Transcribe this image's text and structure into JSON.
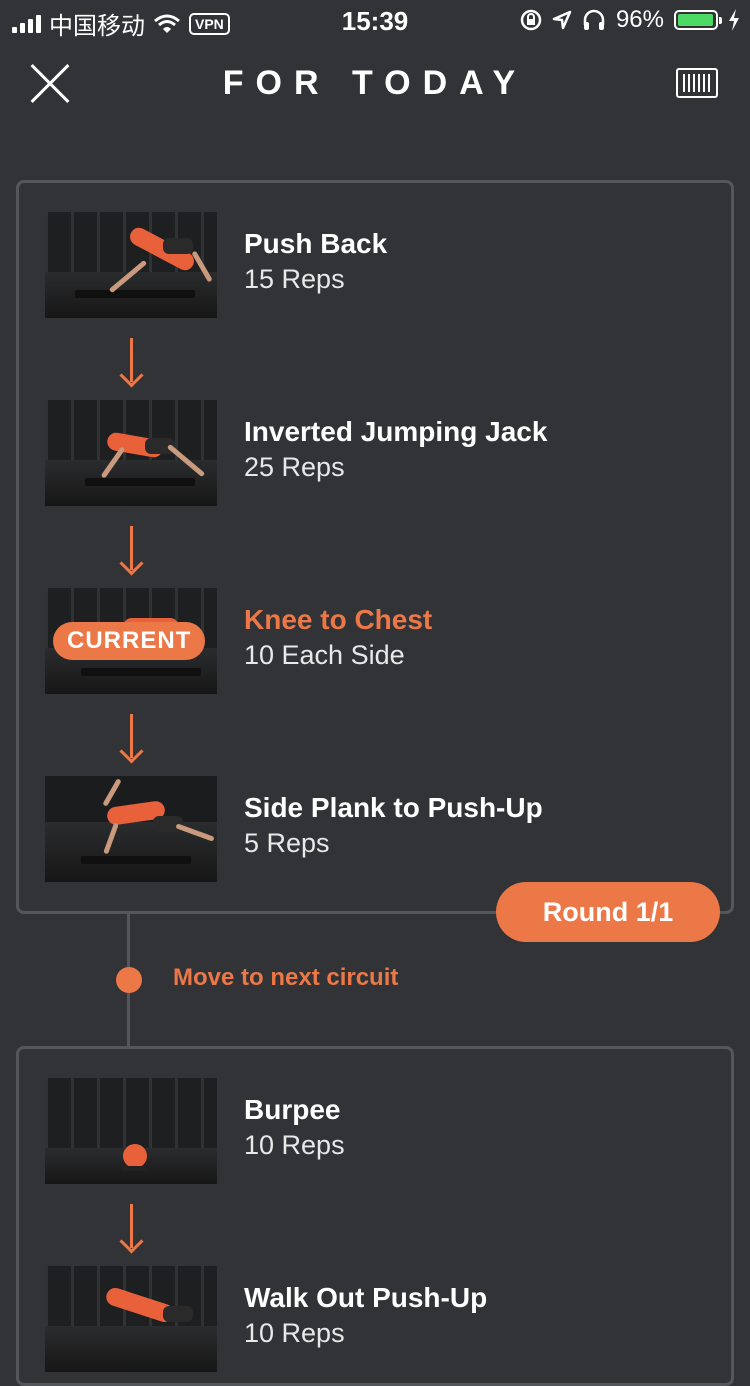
{
  "status_bar": {
    "carrier": "中国移动",
    "vpn": "VPN",
    "time": "15:39",
    "battery": "96%",
    "battery_level": 0.96
  },
  "header": {
    "title": "FOR TODAY",
    "close_icon": "close-icon",
    "barcode_icon": "barcode-icon"
  },
  "circuits": [
    {
      "exercises": [
        {
          "name": "Push Back",
          "reps": "15 Reps"
        },
        {
          "name": "Inverted Jumping Jack",
          "reps": "25 Reps"
        },
        {
          "name": "Knee to Chest",
          "reps": "10 Each Side",
          "badge": "CURRENT"
        },
        {
          "name": "Side Plank to Push-Up",
          "reps": "5 Reps"
        }
      ],
      "round": "Round 1/1"
    },
    {
      "exercises": [
        {
          "name": "Burpee",
          "reps": "10 Reps"
        },
        {
          "name": "Walk Out Push-Up",
          "reps": "10 Reps"
        }
      ]
    }
  ],
  "transition": {
    "label": "Move to next circuit"
  },
  "colors": {
    "accent": "#ec7847",
    "background": "#313336",
    "card_border": "#53565b"
  }
}
